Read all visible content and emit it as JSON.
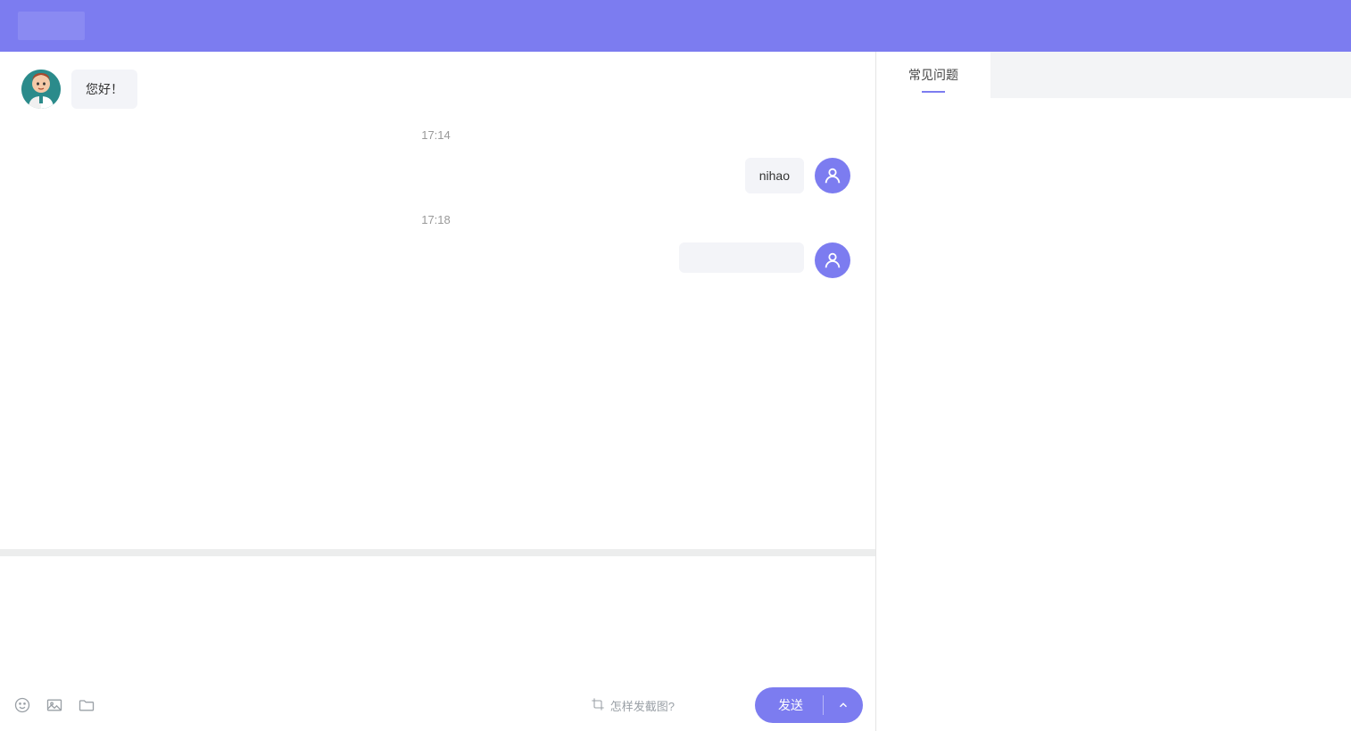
{
  "colors": {
    "primary": "#7c7cf0"
  },
  "chat": {
    "messages": {
      "agent_greeting": "您好！",
      "user_1": "nihao"
    },
    "timestamps": {
      "t1": "17:14",
      "t2": "17:18"
    }
  },
  "input": {
    "screenshot_hint": "怎样发截图?",
    "send_label": "发送",
    "placeholder": ""
  },
  "side": {
    "faq_tab": "常见问题"
  }
}
